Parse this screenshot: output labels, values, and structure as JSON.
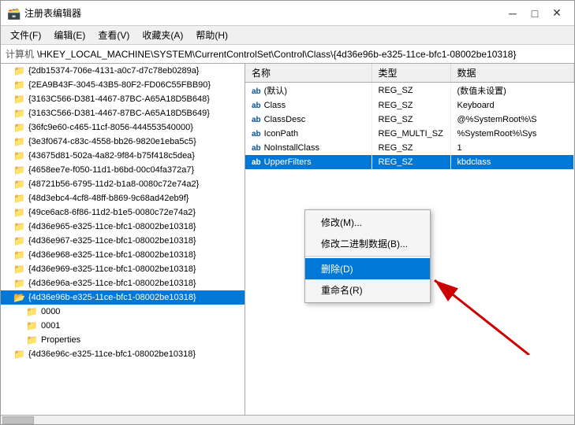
{
  "window": {
    "title": "注册表编辑器",
    "icon": "regedit-icon"
  },
  "title_controls": {
    "minimize": "─",
    "maximize": "□",
    "close": "✕"
  },
  "menu": {
    "items": [
      "文件(F)",
      "编辑(E)",
      "查看(V)",
      "收藏夹(A)",
      "帮助(H)"
    ]
  },
  "address": {
    "label": "计算机",
    "path": "\\HKEY_LOCAL_MACHINE\\SYSTEM\\CurrentControlSet\\Control\\Class\\{4d36e96b-e325-11ce-bfc1-08002be10318}"
  },
  "left_tree": {
    "items": [
      {
        "id": "item1",
        "label": "{2db15374-706e-4131-a0c7-d7c78eb0289a}",
        "level": 0
      },
      {
        "id": "item2",
        "label": "{2EA9B43F-3045-43B5-80F2-FD06C55FBB90}",
        "level": 0
      },
      {
        "id": "item3",
        "label": "{3163C566-D381-4467-87BC-A65A18D5B648}",
        "level": 0
      },
      {
        "id": "item4",
        "label": "{3163C566-D381-4467-87BC-A65A18D5B649}",
        "level": 0
      },
      {
        "id": "item5",
        "label": "{36fc9e60-c465-11cf-8056-444553540000}",
        "level": 0
      },
      {
        "id": "item6",
        "label": "{3e3f0674-c83c-4558-bb26-9820e1eba5c5}",
        "level": 0
      },
      {
        "id": "item7",
        "label": "{43675d81-502a-4a82-9f84-b75f418c5dea}",
        "level": 0
      },
      {
        "id": "item8",
        "label": "{4658ee7e-f050-11d1-b6bd-00c04fa372a7}",
        "level": 0
      },
      {
        "id": "item9",
        "label": "{48721b56-6795-11d2-b1a8-0080c72e74a2}",
        "level": 0
      },
      {
        "id": "item10",
        "label": "{48d3ebc4-4cf8-48ff-b869-9c68ad42eb9f}",
        "level": 0
      },
      {
        "id": "item11",
        "label": "{49ce6ac8-6f86-11d2-b1e5-0080c72e74a2}",
        "level": 0
      },
      {
        "id": "item12",
        "label": "{4d36e965-e325-11ce-bfc1-08002be10318}",
        "level": 0
      },
      {
        "id": "item13",
        "label": "{4d36e967-e325-11ce-bfc1-08002be10318}",
        "level": 0
      },
      {
        "id": "item14",
        "label": "{4d36e968-e325-11ce-bfc1-08002be10318}",
        "level": 0
      },
      {
        "id": "item15",
        "label": "{4d36e969-e325-11ce-bfc1-08002be10318}",
        "level": 0
      },
      {
        "id": "item16",
        "label": "{4d36e96a-e325-11ce-bfc1-08002be10318}",
        "level": 0
      },
      {
        "id": "item17",
        "label": "{4d36e96b-e325-11ce-bfc1-08002be10318}",
        "level": 0,
        "selected": true
      },
      {
        "id": "item18",
        "label": "0000",
        "level": 1
      },
      {
        "id": "item19",
        "label": "0001",
        "level": 1
      },
      {
        "id": "item20",
        "label": "Properties",
        "level": 1
      },
      {
        "id": "item21",
        "label": "{4d36e96c-e325-11ce-bfc1-08002be10318}",
        "level": 0
      }
    ]
  },
  "right_table": {
    "columns": [
      "名称",
      "类型",
      "数据"
    ],
    "rows": [
      {
        "name": "(默认)",
        "ab": true,
        "type": "REG_SZ",
        "data": "(数值未设置)"
      },
      {
        "name": "Class",
        "ab": true,
        "type": "REG_SZ",
        "data": "Keyboard"
      },
      {
        "name": "ClassDesc",
        "ab": true,
        "type": "REG_SZ",
        "data": "@%SystemRoot%\\S"
      },
      {
        "name": "IconPath",
        "ab": true,
        "type": "REG_MULTI_SZ",
        "data": "%SystemRoot%\\Sys"
      },
      {
        "name": "NoInstallClass",
        "ab": true,
        "type": "REG_SZ",
        "data": "1"
      },
      {
        "name": "UpperFilters",
        "ab": true,
        "type": "REG_SZ",
        "data": "kbdclass",
        "selected": true
      }
    ]
  },
  "context_menu": {
    "items": [
      {
        "id": "modify",
        "label": "修改(M)...",
        "highlighted": false
      },
      {
        "id": "modify_bin",
        "label": "修改二进制数据(B)...",
        "highlighted": false
      },
      {
        "id": "delete",
        "label": "删除(D)",
        "highlighted": true
      },
      {
        "id": "rename",
        "label": "重命名(R)",
        "highlighted": false
      }
    ]
  },
  "colors": {
    "selected_bg": "#0078d7",
    "highlight_bg": "#0078d7",
    "window_bg": "#f0f0f0",
    "title_bg": "#ffffff",
    "menu_bg": "#f0f0f0"
  }
}
